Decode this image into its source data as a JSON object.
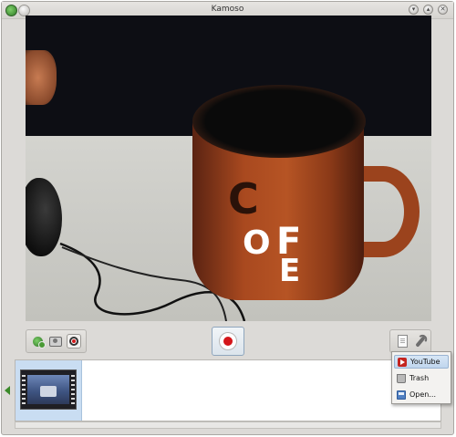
{
  "window": {
    "title": "Kamoso",
    "controls": [
      "minimize",
      "maximize",
      "close"
    ]
  },
  "toolbar": {
    "modes": [
      {
        "name": "photo",
        "icon": "camera-photo-icon"
      },
      {
        "name": "burst",
        "icon": "burst-icon"
      },
      {
        "name": "video",
        "icon": "record-icon",
        "selected": true
      }
    ],
    "record_icon": "record-icon"
  },
  "share_menu": {
    "items": [
      {
        "label": "YouTube",
        "icon": "youtube-icon",
        "highlighted": true
      },
      {
        "label": "Trash",
        "icon": "trash-icon"
      },
      {
        "label": "Open...",
        "icon": "open-icon"
      }
    ]
  },
  "colors": {
    "record_red": "#d4161a",
    "selection_blue": "#c9ddf2",
    "window_bg": "#dcdad7"
  }
}
